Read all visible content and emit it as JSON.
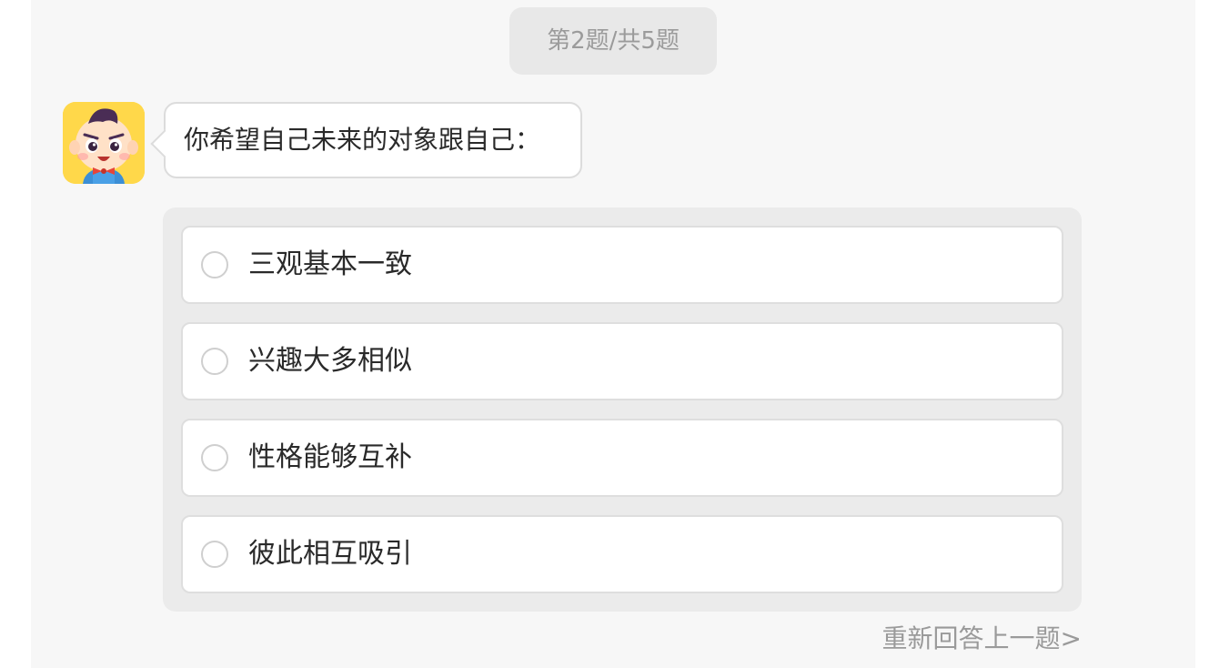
{
  "header": {
    "progress_text": "第2题/共5题"
  },
  "question": {
    "text": "你希望自己未来的对象跟自己："
  },
  "options": [
    {
      "label": "三观基本一致"
    },
    {
      "label": "兴趣大多相似"
    },
    {
      "label": "性格能够互补"
    },
    {
      "label": "彼此相互吸引"
    }
  ],
  "footer": {
    "redo_label": "重新回答上一题>"
  },
  "colors": {
    "panel_bg": "#f7f7f7",
    "options_bg": "#ebebeb",
    "avatar_bg": "#ffd84a",
    "muted_text": "#9a9a9a"
  }
}
